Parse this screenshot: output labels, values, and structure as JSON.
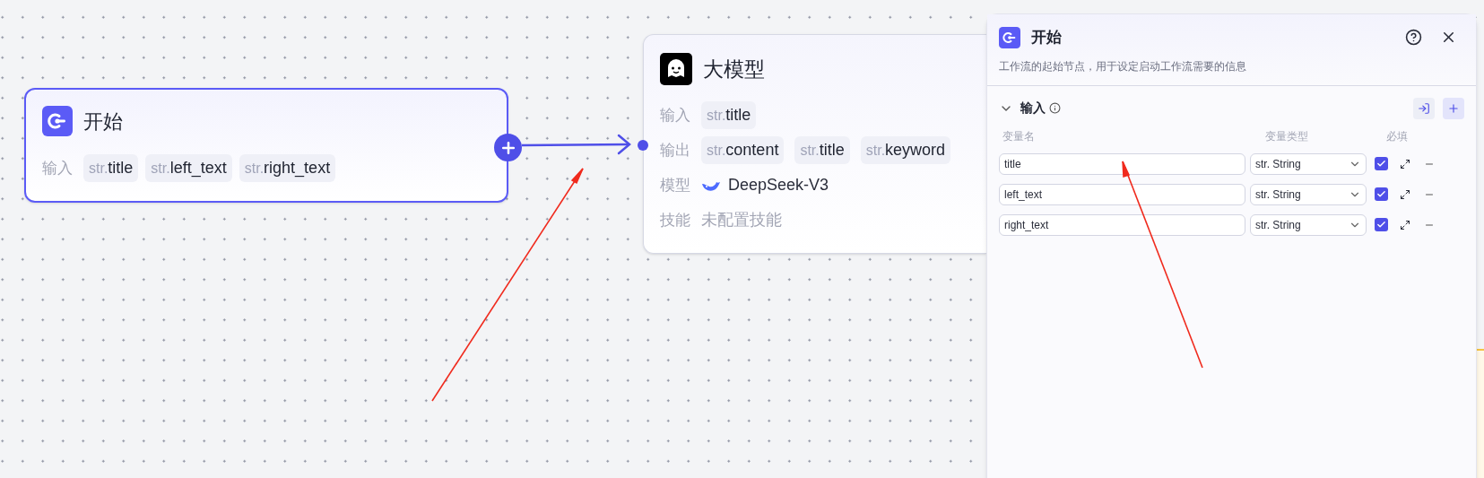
{
  "start_node": {
    "title": "开始",
    "input_label": "输入",
    "inputs": [
      {
        "prefix": "str.",
        "name": "title"
      },
      {
        "prefix": "str.",
        "name": "left_text"
      },
      {
        "prefix": "str.",
        "name": "right_text"
      }
    ]
  },
  "llm_node": {
    "title": "大模型",
    "rows": [
      {
        "kind": "tags",
        "label": "输入",
        "tags": [
          {
            "prefix": "str.",
            "name": "title"
          }
        ]
      },
      {
        "kind": "tags",
        "label": "输出",
        "tags": [
          {
            "prefix": "str.",
            "name": "content"
          },
          {
            "prefix": "str.",
            "name": "title"
          },
          {
            "prefix": "str.",
            "name": "keyword"
          }
        ]
      },
      {
        "kind": "model",
        "label": "模型",
        "value": "DeepSeek-V3"
      },
      {
        "kind": "empty",
        "label": "技能",
        "value": "未配置技能"
      }
    ]
  },
  "panel": {
    "title": "开始",
    "description": "工作流的起始节点，用于设定启动工作流需要的信息",
    "section": {
      "title": "输入",
      "expanded": true,
      "columns": [
        "变量名",
        "变量类型",
        "必填"
      ],
      "rows": [
        {
          "name": "title",
          "type": "str. String",
          "required": true
        },
        {
          "name": "left_text",
          "type": "str. String",
          "required": true
        },
        {
          "name": "right_text",
          "type": "str. String",
          "required": true
        }
      ]
    }
  }
}
